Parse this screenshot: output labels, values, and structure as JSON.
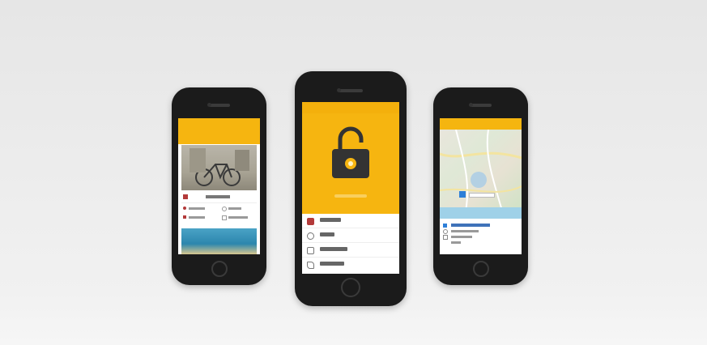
{
  "phones": {
    "left": {
      "screen": "list-view",
      "detail_title": ""
    },
    "center": {
      "screen": "unlock-view"
    },
    "right": {
      "screen": "map-view"
    }
  },
  "colors": {
    "accent": "#f5b50f",
    "phone_body": "#1b1b1b",
    "background": "#ebebeb"
  },
  "icons": [
    "lock-icon",
    "calendar-icon",
    "clock-icon",
    "home-icon",
    "phone-icon",
    "pin-icon"
  ]
}
